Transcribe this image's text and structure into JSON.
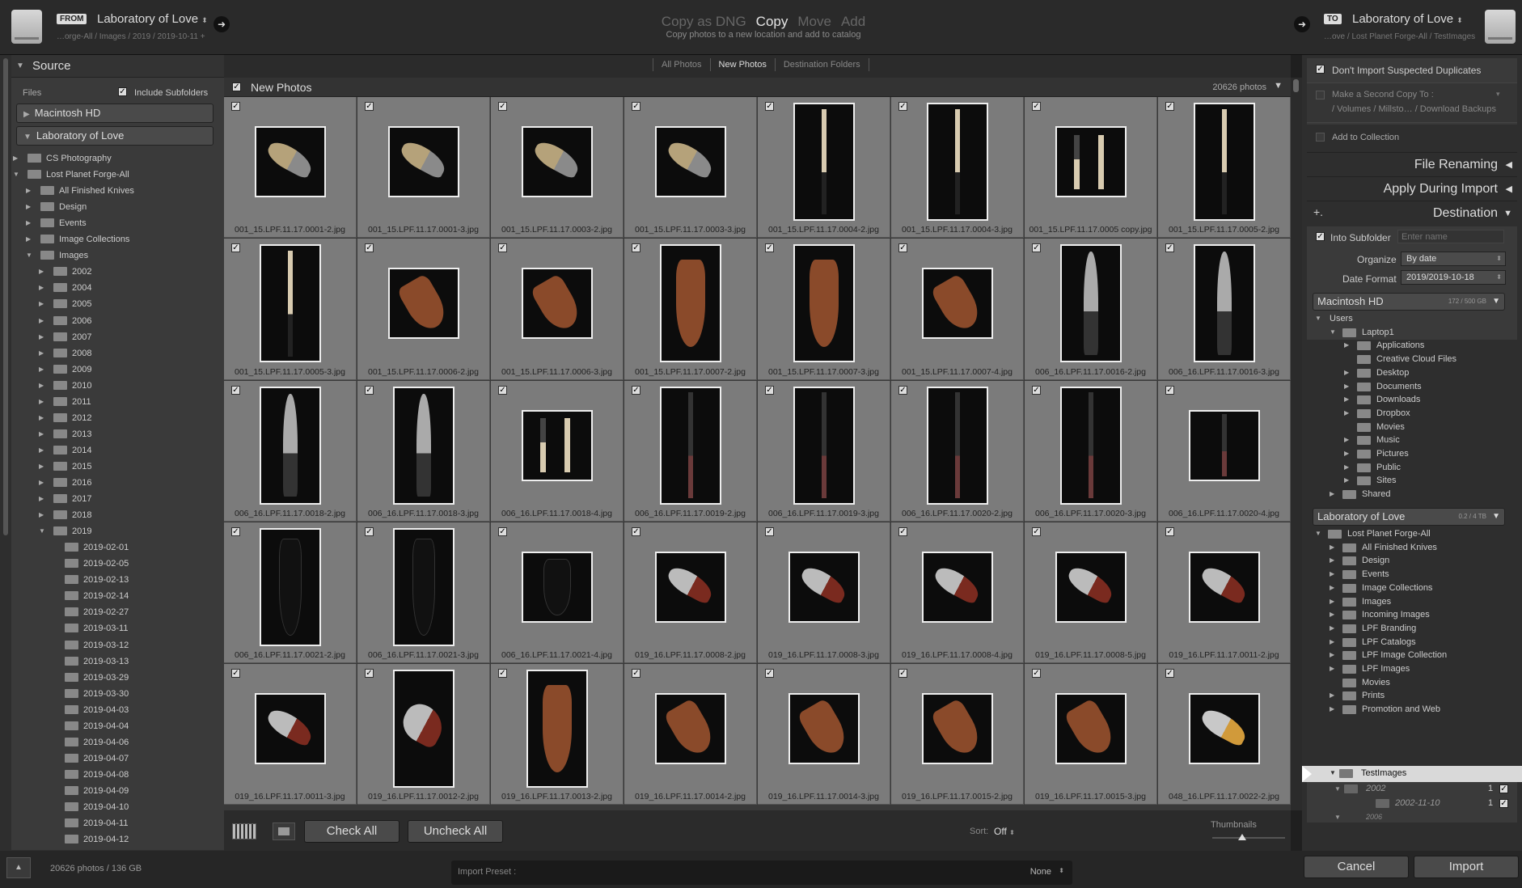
{
  "header": {
    "from_tag": "FROM",
    "from_source": "Laboratory of Love",
    "from_path": "…orge-All / Images / 2019 / 2019-10-11 +",
    "modes": [
      "Copy as DNG",
      "Copy",
      "Move",
      "Add"
    ],
    "mode_subtitle": "Copy photos to a new location and add to catalog",
    "to_tag": "TO",
    "to_dest": "Laboratory of Love",
    "to_path": "…ove / Lost Planet Forge-All / TestImages"
  },
  "source": {
    "title": "Source",
    "files_label": "Files",
    "include_subfolders": "Include Subfolders",
    "macintosh": "Macintosh HD",
    "lab": "Laboratory of Love",
    "tree": [
      {
        "label": "CS Photography",
        "depth": 1,
        "tri": "▶"
      },
      {
        "label": "Lost Planet Forge-All",
        "depth": 1,
        "tri": "▼"
      },
      {
        "label": "All Finished Knives",
        "depth": 2,
        "tri": "▶"
      },
      {
        "label": "Design",
        "depth": 2,
        "tri": "▶"
      },
      {
        "label": "Events",
        "depth": 2,
        "tri": "▶"
      },
      {
        "label": "Image Collections",
        "depth": 2,
        "tri": "▶"
      },
      {
        "label": "Images",
        "depth": 2,
        "tri": "▼"
      },
      {
        "label": "2002",
        "depth": 3,
        "tri": "▶"
      },
      {
        "label": "2004",
        "depth": 3,
        "tri": "▶"
      },
      {
        "label": "2005",
        "depth": 3,
        "tri": "▶"
      },
      {
        "label": "2006",
        "depth": 3,
        "tri": "▶"
      },
      {
        "label": "2007",
        "depth": 3,
        "tri": "▶"
      },
      {
        "label": "2008",
        "depth": 3,
        "tri": "▶"
      },
      {
        "label": "2009",
        "depth": 3,
        "tri": "▶"
      },
      {
        "label": "2010",
        "depth": 3,
        "tri": "▶"
      },
      {
        "label": "2011",
        "depth": 3,
        "tri": "▶"
      },
      {
        "label": "2012",
        "depth": 3,
        "tri": "▶"
      },
      {
        "label": "2013",
        "depth": 3,
        "tri": "▶"
      },
      {
        "label": "2014",
        "depth": 3,
        "tri": "▶"
      },
      {
        "label": "2015",
        "depth": 3,
        "tri": "▶"
      },
      {
        "label": "2016",
        "depth": 3,
        "tri": "▶"
      },
      {
        "label": "2017",
        "depth": 3,
        "tri": "▶"
      },
      {
        "label": "2018",
        "depth": 3,
        "tri": "▶"
      },
      {
        "label": "2019",
        "depth": 3,
        "tri": "▼"
      },
      {
        "label": "2019-02-01",
        "depth": 4,
        "tri": ""
      },
      {
        "label": "2019-02-05",
        "depth": 4,
        "tri": ""
      },
      {
        "label": "2019-02-13",
        "depth": 4,
        "tri": ""
      },
      {
        "label": "2019-02-14",
        "depth": 4,
        "tri": ""
      },
      {
        "label": "2019-02-27",
        "depth": 4,
        "tri": ""
      },
      {
        "label": "2019-03-11",
        "depth": 4,
        "tri": ""
      },
      {
        "label": "2019-03-12",
        "depth": 4,
        "tri": ""
      },
      {
        "label": "2019-03-13",
        "depth": 4,
        "tri": ""
      },
      {
        "label": "2019-03-29",
        "depth": 4,
        "tri": ""
      },
      {
        "label": "2019-03-30",
        "depth": 4,
        "tri": ""
      },
      {
        "label": "2019-04-03",
        "depth": 4,
        "tri": ""
      },
      {
        "label": "2019-04-04",
        "depth": 4,
        "tri": ""
      },
      {
        "label": "2019-04-06",
        "depth": 4,
        "tri": ""
      },
      {
        "label": "2019-04-07",
        "depth": 4,
        "tri": ""
      },
      {
        "label": "2019-04-08",
        "depth": 4,
        "tri": ""
      },
      {
        "label": "2019-04-09",
        "depth": 4,
        "tri": ""
      },
      {
        "label": "2019-04-10",
        "depth": 4,
        "tri": ""
      },
      {
        "label": "2019-04-11",
        "depth": 4,
        "tri": ""
      },
      {
        "label": "2019-04-12",
        "depth": 4,
        "tri": ""
      }
    ]
  },
  "tabs": [
    "All Photos",
    "New Photos",
    "Destination Folders"
  ],
  "grid": {
    "title": "New Photos",
    "count": "20626 photos",
    "photos": [
      {
        "name": "001_15.LPF.11.17.0001-2.jpg",
        "shape": "wide",
        "kind": "blade"
      },
      {
        "name": "001_15.LPF.11.17.0001-3.jpg",
        "shape": "wide",
        "kind": "blade"
      },
      {
        "name": "001_15.LPF.11.17.0003-2.jpg",
        "shape": "wide",
        "kind": "blade"
      },
      {
        "name": "001_15.LPF.11.17.0003-3.jpg",
        "shape": "wide",
        "kind": "blade"
      },
      {
        "name": "001_15.LPF.11.17.0004-2.jpg",
        "shape": "tall",
        "kind": "handle"
      },
      {
        "name": "001_15.LPF.11.17.0004-3.jpg",
        "shape": "tall",
        "kind": "handle"
      },
      {
        "name": "001_15.LPF.11.17.0005 copy.jpg",
        "shape": "wide",
        "kind": "pair"
      },
      {
        "name": "001_15.LPF.11.17.0005-2.jpg",
        "shape": "tall",
        "kind": "handle"
      },
      {
        "name": "001_15.LPF.11.17.0005-3.jpg",
        "shape": "tall",
        "kind": "handle"
      },
      {
        "name": "001_15.LPF.11.17.0006-2.jpg",
        "shape": "wide",
        "kind": "sheath"
      },
      {
        "name": "001_15.LPF.11.17.0006-3.jpg",
        "shape": "wide",
        "kind": "sheath"
      },
      {
        "name": "001_15.LPF.11.17.0007-2.jpg",
        "shape": "tall",
        "kind": "sheath"
      },
      {
        "name": "001_15.LPF.11.17.0007-3.jpg",
        "shape": "tall",
        "kind": "sheath"
      },
      {
        "name": "001_15.LPF.11.17.0007-4.jpg",
        "shape": "wide",
        "kind": "sheath"
      },
      {
        "name": "006_16.LPF.11.17.0016-2.jpg",
        "shape": "tall",
        "kind": "chef"
      },
      {
        "name": "006_16.LPF.11.17.0016-3.jpg",
        "shape": "tall",
        "kind": "chef"
      },
      {
        "name": "006_16.LPF.11.17.0018-2.jpg",
        "shape": "tall",
        "kind": "chef"
      },
      {
        "name": "006_16.LPF.11.17.0018-3.jpg",
        "shape": "tall",
        "kind": "chef"
      },
      {
        "name": "006_16.LPF.11.17.0018-4.jpg",
        "shape": "wide",
        "kind": "pair"
      },
      {
        "name": "006_16.LPF.11.17.0019-2.jpg",
        "shape": "tall",
        "kind": "dark"
      },
      {
        "name": "006_16.LPF.11.17.0019-3.jpg",
        "shape": "tall",
        "kind": "dark"
      },
      {
        "name": "006_16.LPF.11.17.0020-2.jpg",
        "shape": "tall",
        "kind": "dark"
      },
      {
        "name": "006_16.LPF.11.17.0020-3.jpg",
        "shape": "tall",
        "kind": "dark"
      },
      {
        "name": "006_16.LPF.11.17.0020-4.jpg",
        "shape": "wide",
        "kind": "dark"
      },
      {
        "name": "006_16.LPF.11.17.0021-2.jpg",
        "shape": "tall",
        "kind": "blacksheath"
      },
      {
        "name": "006_16.LPF.11.17.0021-3.jpg",
        "shape": "tall",
        "kind": "blacksheath"
      },
      {
        "name": "006_16.LPF.11.17.0021-4.jpg",
        "shape": "wide",
        "kind": "blacksheath"
      },
      {
        "name": "019_16.LPF.11.17.0008-2.jpg",
        "shape": "wide",
        "kind": "redblade"
      },
      {
        "name": "019_16.LPF.11.17.0008-3.jpg",
        "shape": "wide",
        "kind": "redblade"
      },
      {
        "name": "019_16.LPF.11.17.0008-4.jpg",
        "shape": "wide",
        "kind": "redblade"
      },
      {
        "name": "019_16.LPF.11.17.0008-5.jpg",
        "shape": "wide",
        "kind": "redblade"
      },
      {
        "name": "019_16.LPF.11.17.0011-2.jpg",
        "shape": "wide",
        "kind": "redblade"
      },
      {
        "name": "019_16.LPF.11.17.0011-3.jpg",
        "shape": "wide",
        "kind": "redblade"
      },
      {
        "name": "019_16.LPF.11.17.0012-2.jpg",
        "shape": "tall",
        "kind": "redblade"
      },
      {
        "name": "019_16.LPF.11.17.0013-2.jpg",
        "shape": "tall",
        "kind": "sheath"
      },
      {
        "name": "019_16.LPF.11.17.0014-2.jpg",
        "shape": "wide",
        "kind": "sheath"
      },
      {
        "name": "019_16.LPF.11.17.0014-3.jpg",
        "shape": "wide",
        "kind": "sheath"
      },
      {
        "name": "019_16.LPF.11.17.0015-2.jpg",
        "shape": "wide",
        "kind": "sheath"
      },
      {
        "name": "019_16.LPF.11.17.0015-3.jpg",
        "shape": "wide",
        "kind": "sheath"
      },
      {
        "name": "048_16.LPF.11.17.0022-2.jpg",
        "shape": "wide",
        "kind": "yellow"
      }
    ]
  },
  "toolbar": {
    "check_all": "Check All",
    "uncheck_all": "Uncheck All",
    "sort_label": "Sort:",
    "sort_value": "Off",
    "thumbnails": "Thumbnails"
  },
  "options": {
    "dont_import": "Don't Import Suspected Duplicates",
    "second_copy": "Make a Second Copy To :",
    "second_copy_path": "/ Volumes / Millsto… / Download Backups",
    "add_collection": "Add to Collection",
    "file_renaming": "File Renaming",
    "apply_during": "Apply During Import",
    "destination": "Destination",
    "into_subfolder": "Into Subfolder",
    "enter_name": "Enter name",
    "organize_label": "Organize",
    "organize_value": "By date",
    "date_format_label": "Date Format",
    "date_format_value": "2019/2019-10-18"
  },
  "dest": {
    "mac": "Macintosh HD",
    "mac_size": "172 / 500 GB",
    "mac_tree": [
      {
        "label": "Users",
        "depth": 0,
        "tri": "▼",
        "folder": false
      },
      {
        "label": "Laptop1",
        "depth": 1,
        "tri": "▼",
        "folder": true
      },
      {
        "label": "Applications",
        "depth": 2,
        "tri": "▶",
        "folder": true
      },
      {
        "label": "Creative Cloud Files",
        "depth": 2,
        "tri": "",
        "folder": true
      },
      {
        "label": "Desktop",
        "depth": 2,
        "tri": "▶",
        "folder": true
      },
      {
        "label": "Documents",
        "depth": 2,
        "tri": "▶",
        "folder": true
      },
      {
        "label": "Downloads",
        "depth": 2,
        "tri": "▶",
        "folder": true
      },
      {
        "label": "Dropbox",
        "depth": 2,
        "tri": "▶",
        "folder": true
      },
      {
        "label": "Movies",
        "depth": 2,
        "tri": "",
        "folder": true
      },
      {
        "label": "Music",
        "depth": 2,
        "tri": "▶",
        "folder": true
      },
      {
        "label": "Pictures",
        "depth": 2,
        "tri": "▶",
        "folder": true
      },
      {
        "label": "Public",
        "depth": 2,
        "tri": "▶",
        "folder": true
      },
      {
        "label": "Sites",
        "depth": 2,
        "tri": "▶",
        "folder": true
      },
      {
        "label": "Shared",
        "depth": 1,
        "tri": "▶",
        "folder": true
      }
    ],
    "lab": "Laboratory of Love",
    "lab_size": "0.2 / 4 TB",
    "lab_tree": [
      {
        "label": "Lost Planet Forge-All",
        "depth": 0,
        "tri": "▼",
        "folder": true
      },
      {
        "label": "All Finished Knives",
        "depth": 1,
        "tri": "▶",
        "folder": true
      },
      {
        "label": "Design",
        "depth": 1,
        "tri": "▶",
        "folder": true
      },
      {
        "label": "Events",
        "depth": 1,
        "tri": "▶",
        "folder": true
      },
      {
        "label": "Image Collections",
        "depth": 1,
        "tri": "▶",
        "folder": true
      },
      {
        "label": "Images",
        "depth": 1,
        "tri": "▶",
        "folder": true
      },
      {
        "label": "Incoming Images",
        "depth": 1,
        "tri": "▶",
        "folder": true
      },
      {
        "label": "LPF Branding",
        "depth": 1,
        "tri": "▶",
        "folder": true
      },
      {
        "label": "LPF Catalogs",
        "depth": 1,
        "tri": "▶",
        "folder": true
      },
      {
        "label": "LPF Image Collection",
        "depth": 1,
        "tri": "▶",
        "folder": true
      },
      {
        "label": "LPF Images",
        "depth": 1,
        "tri": "▶",
        "folder": true
      },
      {
        "label": "Movies",
        "depth": 1,
        "tri": "",
        "folder": true
      },
      {
        "label": "Prints",
        "depth": 1,
        "tri": "▶",
        "folder": true
      },
      {
        "label": "Promotion and Web",
        "depth": 1,
        "tri": "▶",
        "folder": true
      }
    ],
    "selected": "TestImages",
    "sub_year": "2002",
    "sub_day": "2002-11-10",
    "sub_count": "1",
    "sub_next": "2006"
  },
  "footer": {
    "status": "20626 photos / 136 GB",
    "preset_label": "Import Preset :",
    "preset_value": "None",
    "cancel": "Cancel",
    "import": "Import"
  }
}
